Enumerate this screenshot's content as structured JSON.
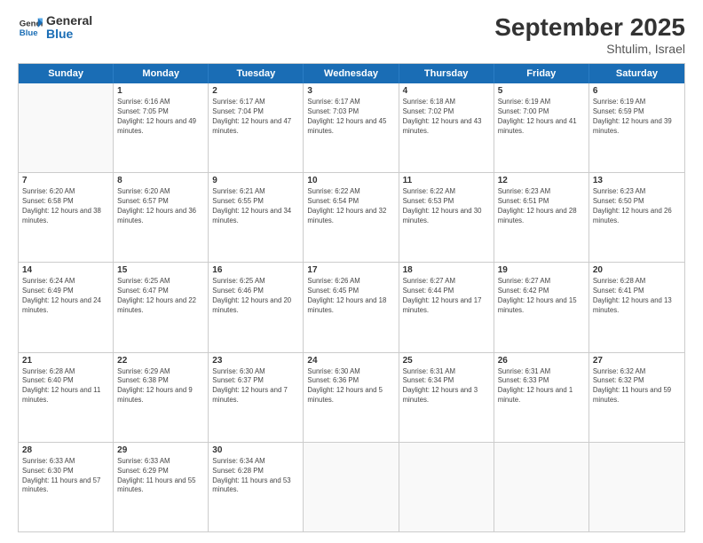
{
  "header": {
    "logo": {
      "line1": "General",
      "line2": "Blue"
    },
    "title": "September 2025",
    "location": "Shtulim, Israel"
  },
  "weekdays": [
    "Sunday",
    "Monday",
    "Tuesday",
    "Wednesday",
    "Thursday",
    "Friday",
    "Saturday"
  ],
  "weeks": [
    [
      {
        "day": "",
        "empty": true
      },
      {
        "day": "1",
        "sunrise": "6:16 AM",
        "sunset": "7:05 PM",
        "daylight": "12 hours and 49 minutes."
      },
      {
        "day": "2",
        "sunrise": "6:17 AM",
        "sunset": "7:04 PM",
        "daylight": "12 hours and 47 minutes."
      },
      {
        "day": "3",
        "sunrise": "6:17 AM",
        "sunset": "7:03 PM",
        "daylight": "12 hours and 45 minutes."
      },
      {
        "day": "4",
        "sunrise": "6:18 AM",
        "sunset": "7:02 PM",
        "daylight": "12 hours and 43 minutes."
      },
      {
        "day": "5",
        "sunrise": "6:19 AM",
        "sunset": "7:00 PM",
        "daylight": "12 hours and 41 minutes."
      },
      {
        "day": "6",
        "sunrise": "6:19 AM",
        "sunset": "6:59 PM",
        "daylight": "12 hours and 39 minutes."
      }
    ],
    [
      {
        "day": "7",
        "sunrise": "6:20 AM",
        "sunset": "6:58 PM",
        "daylight": "12 hours and 38 minutes."
      },
      {
        "day": "8",
        "sunrise": "6:20 AM",
        "sunset": "6:57 PM",
        "daylight": "12 hours and 36 minutes."
      },
      {
        "day": "9",
        "sunrise": "6:21 AM",
        "sunset": "6:55 PM",
        "daylight": "12 hours and 34 minutes."
      },
      {
        "day": "10",
        "sunrise": "6:22 AM",
        "sunset": "6:54 PM",
        "daylight": "12 hours and 32 minutes."
      },
      {
        "day": "11",
        "sunrise": "6:22 AM",
        "sunset": "6:53 PM",
        "daylight": "12 hours and 30 minutes."
      },
      {
        "day": "12",
        "sunrise": "6:23 AM",
        "sunset": "6:51 PM",
        "daylight": "12 hours and 28 minutes."
      },
      {
        "day": "13",
        "sunrise": "6:23 AM",
        "sunset": "6:50 PM",
        "daylight": "12 hours and 26 minutes."
      }
    ],
    [
      {
        "day": "14",
        "sunrise": "6:24 AM",
        "sunset": "6:49 PM",
        "daylight": "12 hours and 24 minutes."
      },
      {
        "day": "15",
        "sunrise": "6:25 AM",
        "sunset": "6:47 PM",
        "daylight": "12 hours and 22 minutes."
      },
      {
        "day": "16",
        "sunrise": "6:25 AM",
        "sunset": "6:46 PM",
        "daylight": "12 hours and 20 minutes."
      },
      {
        "day": "17",
        "sunrise": "6:26 AM",
        "sunset": "6:45 PM",
        "daylight": "12 hours and 18 minutes."
      },
      {
        "day": "18",
        "sunrise": "6:27 AM",
        "sunset": "6:44 PM",
        "daylight": "12 hours and 17 minutes."
      },
      {
        "day": "19",
        "sunrise": "6:27 AM",
        "sunset": "6:42 PM",
        "daylight": "12 hours and 15 minutes."
      },
      {
        "day": "20",
        "sunrise": "6:28 AM",
        "sunset": "6:41 PM",
        "daylight": "12 hours and 13 minutes."
      }
    ],
    [
      {
        "day": "21",
        "sunrise": "6:28 AM",
        "sunset": "6:40 PM",
        "daylight": "12 hours and 11 minutes."
      },
      {
        "day": "22",
        "sunrise": "6:29 AM",
        "sunset": "6:38 PM",
        "daylight": "12 hours and 9 minutes."
      },
      {
        "day": "23",
        "sunrise": "6:30 AM",
        "sunset": "6:37 PM",
        "daylight": "12 hours and 7 minutes."
      },
      {
        "day": "24",
        "sunrise": "6:30 AM",
        "sunset": "6:36 PM",
        "daylight": "12 hours and 5 minutes."
      },
      {
        "day": "25",
        "sunrise": "6:31 AM",
        "sunset": "6:34 PM",
        "daylight": "12 hours and 3 minutes."
      },
      {
        "day": "26",
        "sunrise": "6:31 AM",
        "sunset": "6:33 PM",
        "daylight": "12 hours and 1 minute."
      },
      {
        "day": "27",
        "sunrise": "6:32 AM",
        "sunset": "6:32 PM",
        "daylight": "11 hours and 59 minutes."
      }
    ],
    [
      {
        "day": "28",
        "sunrise": "6:33 AM",
        "sunset": "6:30 PM",
        "daylight": "11 hours and 57 minutes."
      },
      {
        "day": "29",
        "sunrise": "6:33 AM",
        "sunset": "6:29 PM",
        "daylight": "11 hours and 55 minutes."
      },
      {
        "day": "30",
        "sunrise": "6:34 AM",
        "sunset": "6:28 PM",
        "daylight": "11 hours and 53 minutes."
      },
      {
        "day": "",
        "empty": true
      },
      {
        "day": "",
        "empty": true
      },
      {
        "day": "",
        "empty": true
      },
      {
        "day": "",
        "empty": true
      }
    ]
  ]
}
